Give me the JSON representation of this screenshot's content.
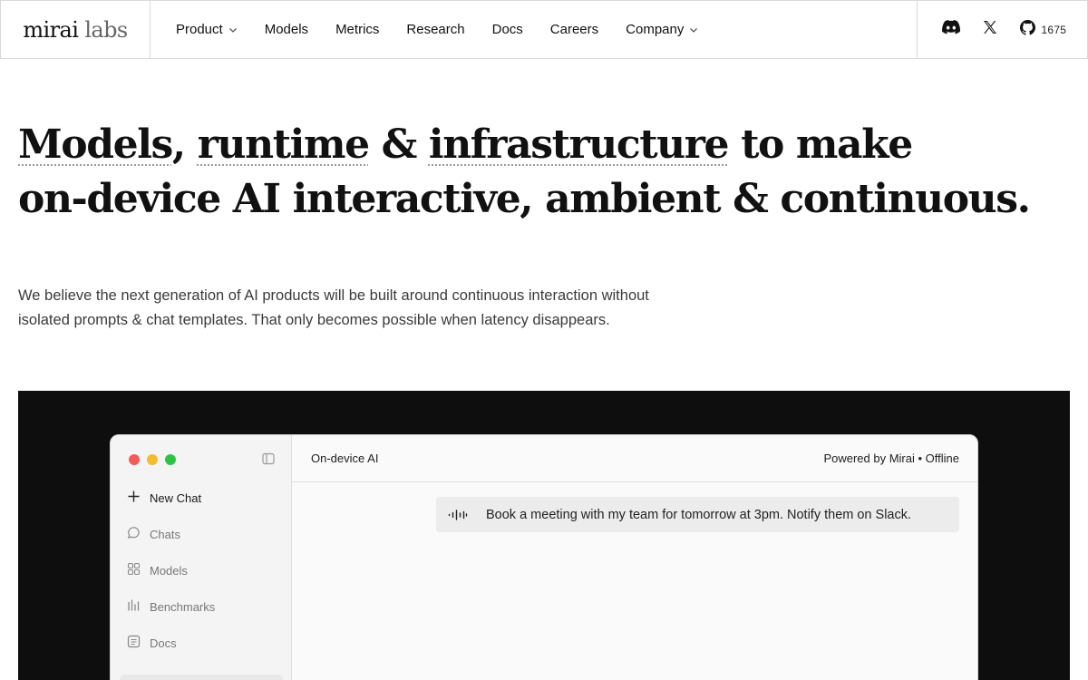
{
  "brand": {
    "name_primary": "mirai",
    "name_secondary": "labs"
  },
  "nav": {
    "items": [
      {
        "label": "Product",
        "has_dropdown": true
      },
      {
        "label": "Models",
        "has_dropdown": false
      },
      {
        "label": "Metrics",
        "has_dropdown": false
      },
      {
        "label": "Research",
        "has_dropdown": false
      },
      {
        "label": "Docs",
        "has_dropdown": false
      },
      {
        "label": "Careers",
        "has_dropdown": false
      },
      {
        "label": "Company",
        "has_dropdown": true
      }
    ],
    "social": {
      "discord_icon": "discord-icon",
      "x_icon": "x-icon",
      "github_icon": "github-icon",
      "github_stars": "1675"
    }
  },
  "hero": {
    "headline": {
      "w1": "Models",
      "sep1": ", ",
      "w2": "runtime",
      "sep2": " & ",
      "w3": "infrastructure",
      "rest1": " to make",
      "line2": "on-device AI interactive, ambient & continuous."
    },
    "lede": {
      "line1": "We believe the next generation of AI products will be built around continuous interaction without",
      "line2": "isolated prompts & chat templates. That only becomes possible when latency disappears."
    }
  },
  "demo": {
    "sidebar": {
      "new_chat": "New Chat",
      "items": [
        {
          "label": "Chats",
          "icon": "chat-bubble-icon"
        },
        {
          "label": "Models",
          "icon": "grid-icon"
        },
        {
          "label": "Benchmarks",
          "icon": "bar-chart-icon"
        },
        {
          "label": "Docs",
          "icon": "document-icon"
        }
      ]
    },
    "header": {
      "title": "On-device AI",
      "status": "Powered by Mirai • Offline"
    },
    "message": {
      "text": "Book a meeting with my team for tomorrow at 3pm. Notify them on Slack.",
      "icon": "audio-wave-icon"
    }
  },
  "colors": {
    "traffic_red": "#f35b57",
    "traffic_yellow": "#f3bc2f",
    "traffic_green": "#2cc445",
    "demo_background": "#0e0e0e"
  }
}
